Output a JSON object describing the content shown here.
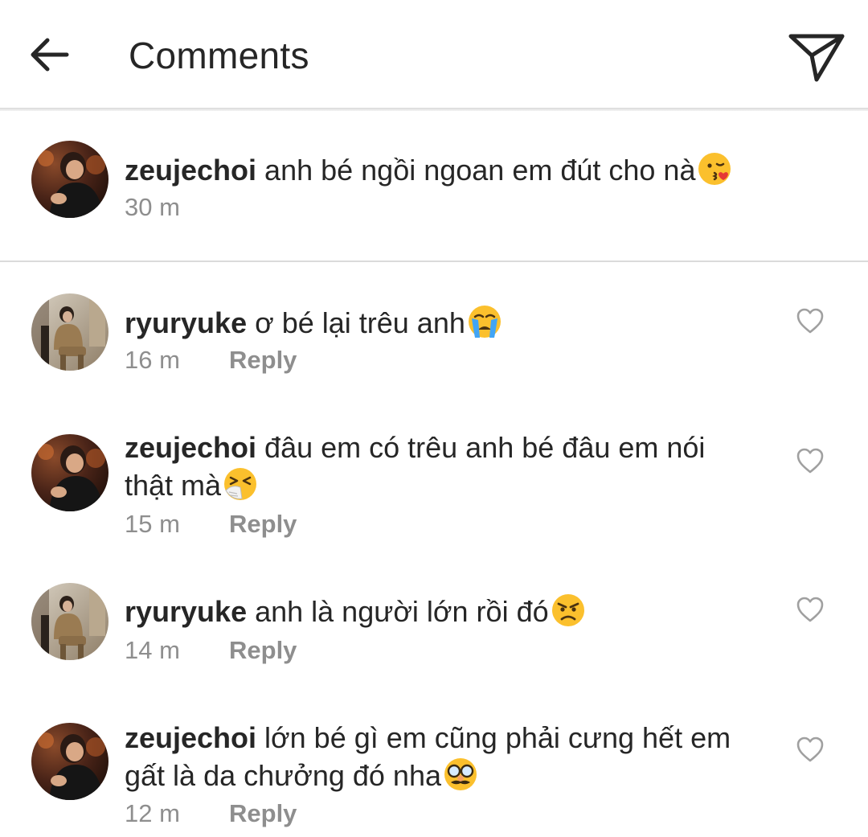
{
  "header": {
    "title": "Comments",
    "back_icon": "arrow-left-icon",
    "share_icon": "paper-plane-icon"
  },
  "caption": {
    "username": "zeujechoi",
    "text": "anh bé ngồi ngoan em đút cho nà",
    "emoji": "kissing-face-emoji",
    "time": "30 m"
  },
  "comments": [
    {
      "username": "ryuryuke",
      "text": "ơ bé lại trêu anh",
      "emoji": "crying-face-emoji",
      "time": "16 m",
      "reply_label": "Reply"
    },
    {
      "username": "zeujechoi",
      "text": "đâu em có trêu anh bé đâu em nói thật mà",
      "emoji": "sneezing-face-emoji",
      "time": "15 m",
      "reply_label": "Reply"
    },
    {
      "username": "ryuryuke",
      "text": "anh là người lớn rồi đó",
      "emoji": "angry-face-emoji",
      "time": "14 m",
      "reply_label": "Reply"
    },
    {
      "username": "zeujechoi",
      "text": "lớn bé gì em cũng phải cưng hết em gất là da chưởng đó nha",
      "emoji": "disguised-face-emoji",
      "time": "12 m",
      "reply_label": "Reply"
    }
  ],
  "colors": {
    "text": "#262626",
    "secondary": "#8e8e8e",
    "divider": "#dbdbdb",
    "emoji_yellow": "#fbc02d"
  }
}
